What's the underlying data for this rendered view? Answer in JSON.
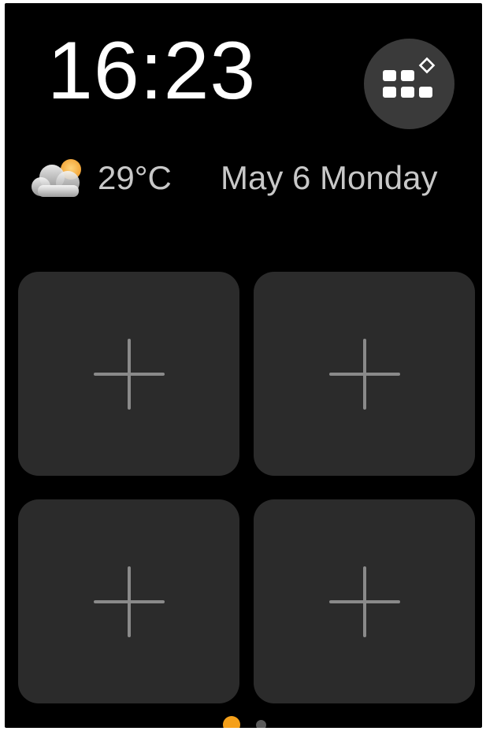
{
  "status": {
    "time": "16:23"
  },
  "weather": {
    "icon": "partly-cloudy-icon",
    "temperature": "29°C"
  },
  "date": {
    "text": "May 6 Monday"
  },
  "apps_button": {
    "icon": "apps-grid-edit-icon"
  },
  "tiles": [
    {
      "icon": "plus-icon"
    },
    {
      "icon": "plus-icon"
    },
    {
      "icon": "plus-icon"
    },
    {
      "icon": "plus-icon"
    }
  ],
  "pagination": {
    "current_page": 1,
    "total_pages": 2
  },
  "colors": {
    "background": "#000000",
    "tile": "#2b2b2b",
    "accent": "#f5a01a",
    "text_primary": "#ffffff",
    "text_secondary": "#c8c8c8"
  }
}
